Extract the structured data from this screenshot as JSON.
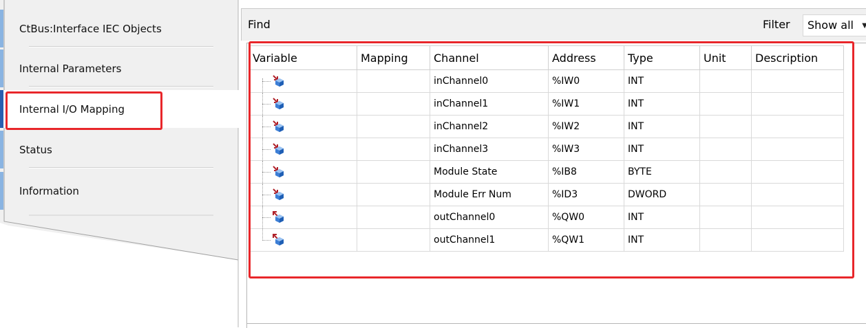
{
  "tabs": [
    {
      "label": "CtBus:Interface IEC Objects",
      "selected": false
    },
    {
      "label": "Internal Parameters",
      "selected": false
    },
    {
      "label": "Internal I/O Mapping",
      "selected": true
    },
    {
      "label": "Status",
      "selected": false
    },
    {
      "label": "Information",
      "selected": false
    }
  ],
  "toolbar": {
    "find_label": "Find",
    "filter_label": "Filter",
    "filter_value": "Show all"
  },
  "columns": [
    "Variable",
    "Mapping",
    "Channel",
    "Address",
    "Type",
    "Unit",
    "Description"
  ],
  "rows": [
    {
      "icon": "input-channel-icon",
      "channel": "inChannel0",
      "address": "%IW0",
      "type": "INT"
    },
    {
      "icon": "input-channel-icon",
      "channel": "inChannel1",
      "address": "%IW1",
      "type": "INT"
    },
    {
      "icon": "input-channel-icon",
      "channel": "inChannel2",
      "address": "%IW2",
      "type": "INT"
    },
    {
      "icon": "input-channel-icon",
      "channel": "inChannel3",
      "address": "%IW3",
      "type": "INT"
    },
    {
      "icon": "input-channel-icon",
      "channel": "Module State",
      "address": "%IB8",
      "type": "BYTE"
    },
    {
      "icon": "input-channel-icon",
      "channel": "Module Err Num",
      "address": "%ID3",
      "type": "DWORD"
    },
    {
      "icon": "output-channel-icon",
      "channel": "outChannel0",
      "address": "%QW0",
      "type": "INT"
    },
    {
      "icon": "output-channel-icon",
      "channel": "outChannel1",
      "address": "%QW1",
      "type": "INT"
    }
  ],
  "colors": {
    "highlight": "#e8262a",
    "tab_accent": "#8ab4e2",
    "tab_accent_selected": "#2a5fb0",
    "panel_bg": "#f0f0f0"
  }
}
